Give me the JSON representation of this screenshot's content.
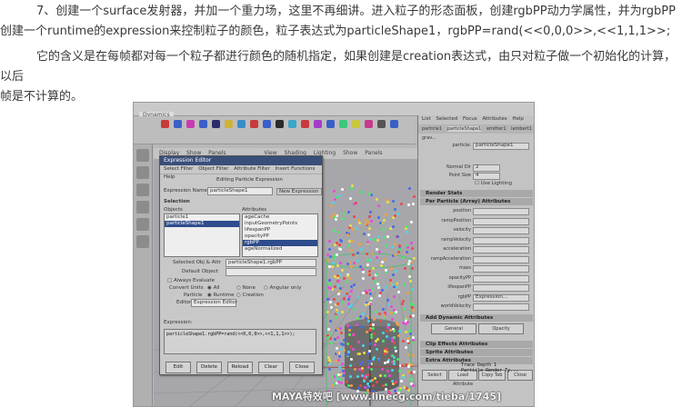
{
  "article": {
    "para1_line1": "7、创建一个surface发射器，并加一个重力场，这里不再细讲。进入粒子的形态面板，创建rgbPP动力学属性，并为rgbPP",
    "para1_line2": "创建一个runtime的expression来控制粒子的颜色，粒子表达式为particleShape1，rgbPP=rand(<<0,0,0>>,<<1,1,1>>;",
    "para2_line1": "它的含义是在每帧都对每一个粒子都进行颜色的随机指定，如果创建是creation表达式，由只对粒子做一个初始化的计算，以后",
    "para2_line2": "帧是不计算的。"
  },
  "screenshot": {
    "mode_menu": "Dynamics",
    "viewport_menu": [
      "View",
      "Shading",
      "Lighting",
      "Show",
      "Panels"
    ],
    "panel_menu": [
      "Display",
      "Show",
      "Panels"
    ],
    "expression_editor": {
      "title": "Expression Editor",
      "menus": [
        "Select Filter",
        "Object Filter",
        "Attribute Filter",
        "Insert Functions",
        "Help"
      ],
      "heading": "Editing Particle Expression",
      "expr_name_label": "Expression Name",
      "expr_name_value": "particleShape1",
      "new_expression": "New Expression",
      "selection_label": "Selection",
      "objects_label": "Objects",
      "attributes_label": "Attributes",
      "objects": [
        "particle1",
        "particleShape1"
      ],
      "attributes": [
        "ageCache",
        "inputGeometryPoints",
        "lifespanPP",
        "opacityPP",
        "rgbPP",
        "ageNormalized"
      ],
      "selected_obj_label": "Selected Obj & Attr",
      "selected_obj_value": "particleShape1.rgbPP",
      "default_object_label": "Default Object",
      "always_evaluate": "Always Evaluate",
      "convert_units": "Convert Units",
      "all": "All",
      "none": "None",
      "angular_only": "Angular only",
      "particle_label": "Particle",
      "runtime": "Runtime",
      "creation": "Creation",
      "editor_label": "Editor",
      "editor_value": "Expression Editor",
      "expression_label": "Expression:",
      "code": "particleShape1.rgbPP=rand(<<0,0,0>>,<<1,1,1>>);",
      "buttons": [
        "Edit",
        "Delete",
        "Reload",
        "Clear",
        "Close"
      ]
    },
    "attribute_editor": {
      "menus": [
        "List",
        "Selected",
        "Focus",
        "Attributes",
        "Help"
      ],
      "tabs": [
        "particle1",
        "particleShape1",
        "emitter1",
        "lambert1",
        "grav..."
      ],
      "particle_label": "particle:",
      "particle_value": "particleShape1",
      "normal_dir_label": "Normal Dir",
      "normal_dir_value": "2",
      "point_size_label": "Point Size",
      "point_size_value": "4",
      "use_lighting": "Use Lighting",
      "sections": [
        "Render Stats",
        "Per Particle (Array) Attributes"
      ],
      "per_particle_attrs": [
        "position",
        "rampPosition",
        "velocity",
        "rampVelocity",
        "acceleration",
        "rampAcceleration",
        "mass",
        "opacityPP",
        "lifespanPP",
        "rgbPP",
        "worldVelocity"
      ],
      "rgbpp_value": "Expression...",
      "add_dynamic": "Add Dynamic Attributes",
      "general_btn": "General",
      "opacity_btn": "Opacity",
      "more_sections": [
        "Clip Effects Attributes",
        "Sprite Attributes",
        "Extra Attributes"
      ],
      "bottom_buttons": [
        "Select",
        "Load Attribute",
        "Copy Tab",
        "Close"
      ]
    },
    "trace_lines": [
      "Trace Depth 1",
      "Particle Render Ty..."
    ]
  },
  "watermark": "MAYA特效吧 [www.linecg.com/tieba/1745]"
}
